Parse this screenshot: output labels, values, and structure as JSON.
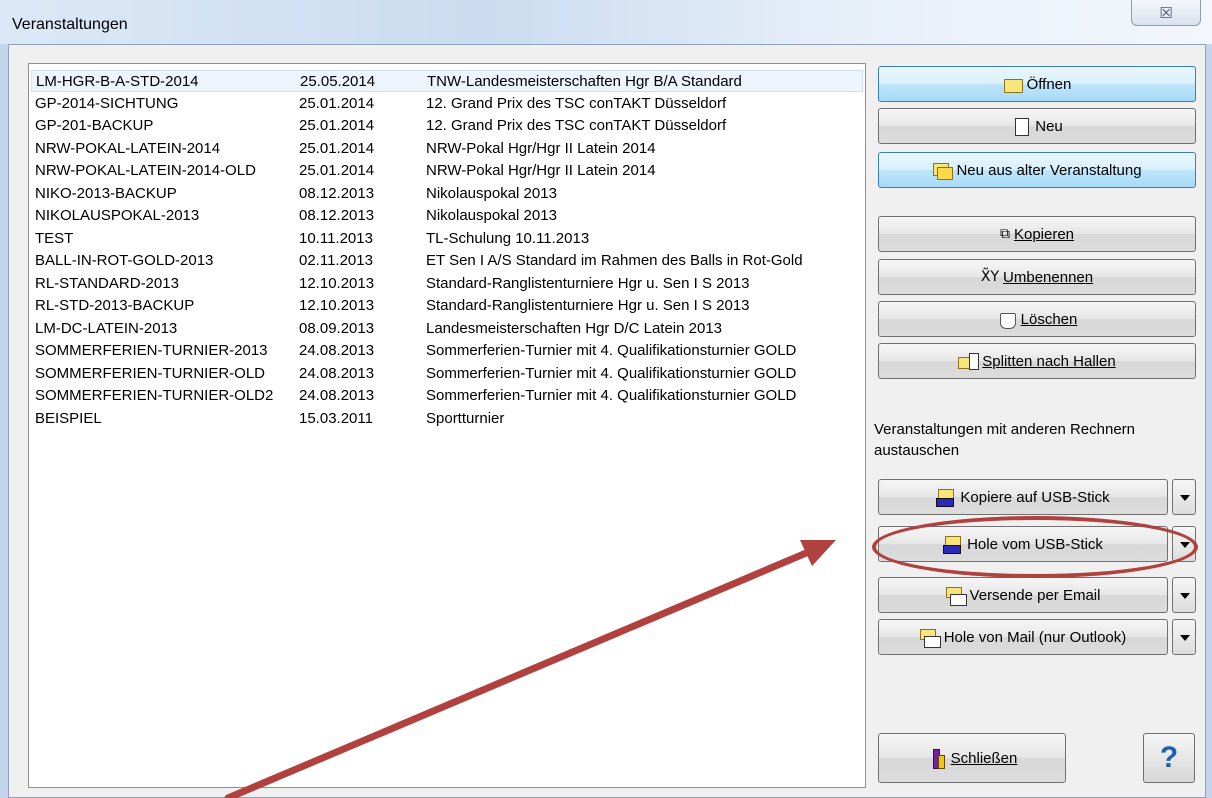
{
  "window": {
    "title": "Veranstaltungen",
    "close_glyph": "☒"
  },
  "events": [
    {
      "name": "LM-HGR-B-A-STD-2014",
      "date": "25.05.2014",
      "desc": "TNW-Landesmeisterschaften Hgr B/A Standard",
      "selected": true
    },
    {
      "name": "GP-2014-SICHTUNG",
      "date": "25.01.2014",
      "desc": "12. Grand Prix des TSC conTAKT Düsseldorf"
    },
    {
      "name": "GP-201-BACKUP",
      "date": "25.01.2014",
      "desc": "12. Grand Prix des TSC conTAKT Düsseldorf"
    },
    {
      "name": "NRW-POKAL-LATEIN-2014",
      "date": "25.01.2014",
      "desc": "NRW-Pokal Hgr/Hgr II Latein 2014"
    },
    {
      "name": "NRW-POKAL-LATEIN-2014-OLD",
      "date": "25.01.2014",
      "desc": "NRW-Pokal Hgr/Hgr II Latein 2014"
    },
    {
      "name": "NIKO-2013-BACKUP",
      "date": "08.12.2013",
      "desc": "Nikolauspokal 2013"
    },
    {
      "name": "NIKOLAUSPOKAL-2013",
      "date": "08.12.2013",
      "desc": "Nikolauspokal 2013"
    },
    {
      "name": "TEST",
      "date": "10.11.2013",
      "desc": "TL-Schulung 10.11.2013"
    },
    {
      "name": "BALL-IN-ROT-GOLD-2013",
      "date": "02.11.2013",
      "desc": "ET Sen I A/S Standard im Rahmen des Balls in Rot-Gold"
    },
    {
      "name": "RL-STANDARD-2013",
      "date": "12.10.2013",
      "desc": "Standard-Ranglistenturniere Hgr u. Sen I S 2013"
    },
    {
      "name": "RL-STD-2013-BACKUP",
      "date": "12.10.2013",
      "desc": "Standard-Ranglistenturniere Hgr u. Sen I S 2013"
    },
    {
      "name": "LM-DC-LATEIN-2013",
      "date": "08.09.2013",
      "desc": "Landesmeisterschaften Hgr D/C Latein 2013"
    },
    {
      "name": "SOMMERFERIEN-TURNIER-2013",
      "date": "24.08.2013",
      "desc": "Sommerferien-Turnier mit 4. Qualifikationsturnier GOLD"
    },
    {
      "name": "SOMMERFERIEN-TURNIER-OLD",
      "date": "24.08.2013",
      "desc": "Sommerferien-Turnier mit 4. Qualifikationsturnier GOLD"
    },
    {
      "name": "SOMMERFERIEN-TURNIER-OLD2",
      "date": "24.08.2013",
      "desc": "Sommerferien-Turnier mit 4. Qualifikationsturnier GOLD"
    },
    {
      "name": "BEISPIEL",
      "date": "15.03.2011",
      "desc": "Sportturnier"
    }
  ],
  "buttons": {
    "open": "Öffnen",
    "new": "Neu",
    "new_from_old": "Neu aus alter Veranstaltung",
    "copy": "Kopieren",
    "rename": "Umbenennen",
    "delete": "Löschen",
    "split": "Splitten nach Hallen",
    "copy_usb": "Kopiere auf USB-Stick",
    "get_usb": "Hole vom USB-Stick",
    "send_mail": "Versende per Email",
    "get_mail": "Hole von Mail (nur Outlook)",
    "close": "Schließen",
    "help": "?"
  },
  "exchange_label": "Veranstaltungen mit anderen Rechnern austauschen",
  "icons": {
    "copy_glyph": "⧉",
    "rename_glyph": "X͂Y"
  },
  "colors": {
    "annotation": "#b0413e",
    "selection": "#eef4fb",
    "hot_button": "#bee6fd"
  }
}
